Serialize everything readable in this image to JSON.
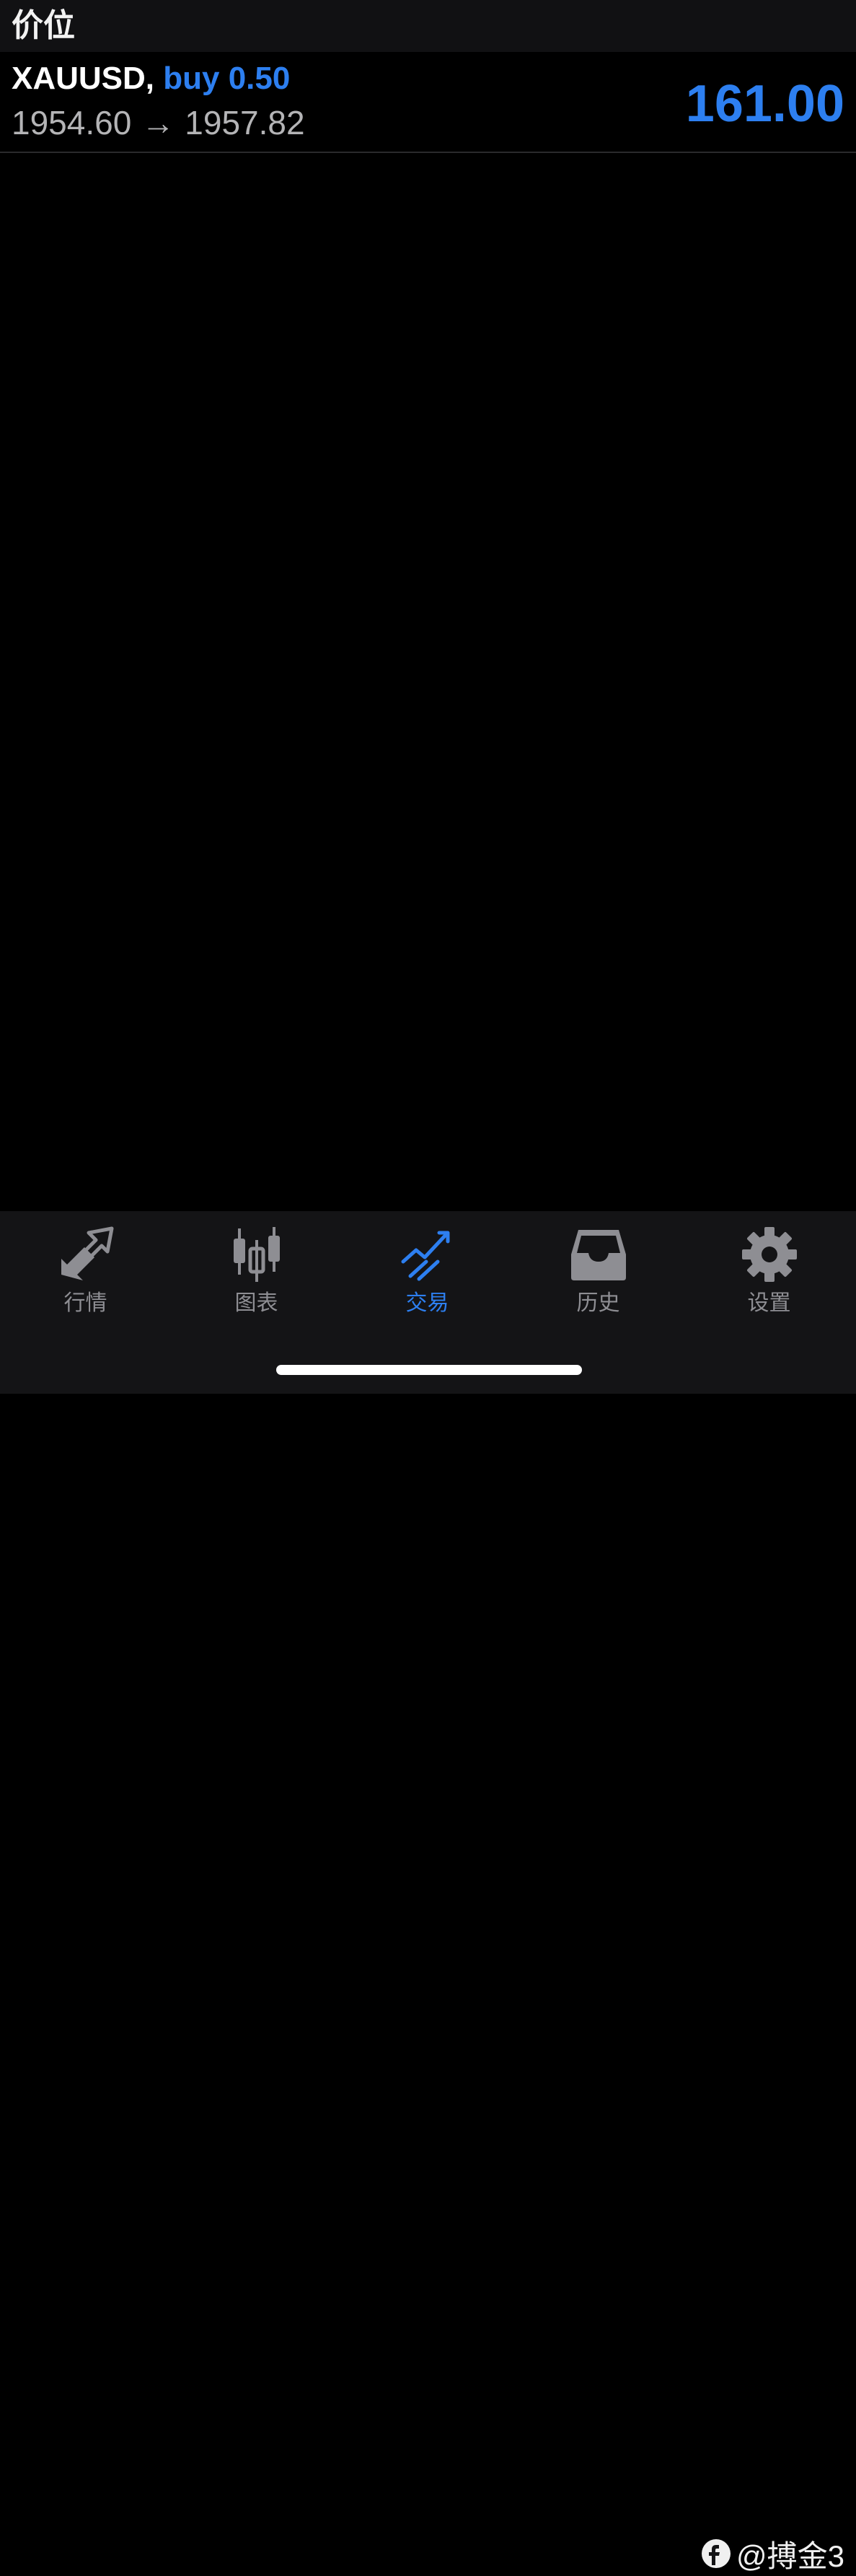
{
  "header": {
    "title": "价位"
  },
  "position": {
    "symbol": "XAUUSD,",
    "side_volume": "buy 0.50",
    "open_price": "1954.60",
    "arrow": "→",
    "current_price": "1957.82",
    "profit": "161.00"
  },
  "tabs": [
    {
      "label": "行情",
      "icon": "quotes-arrows-icon",
      "active": false
    },
    {
      "label": "图表",
      "icon": "candlestick-chart-icon",
      "active": false
    },
    {
      "label": "交易",
      "icon": "trade-trend-icon",
      "active": true
    },
    {
      "label": "历史",
      "icon": "history-inbox-icon",
      "active": false
    },
    {
      "label": "设置",
      "icon": "gear-icon",
      "active": false
    }
  ],
  "watermark": {
    "text": "@搏金3"
  },
  "colors": {
    "accent": "#2d7ff0",
    "inactive": "#8e8e93",
    "background": "#000000"
  }
}
